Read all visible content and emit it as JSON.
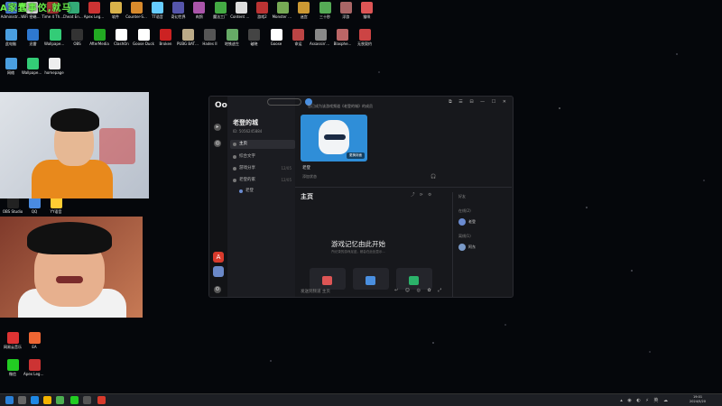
{
  "overlay_title": "A家蠢事佼,就马",
  "desktop_icons": [
    {
      "label": "Administr...",
      "color": "#4a7fd6"
    },
    {
      "label": "WiFi 密碼查看器",
      "color": "#d9d9d9"
    },
    {
      "label": "Time 4 The Nightmar...",
      "color": "#a33"
    },
    {
      "label": "Cheat Engine",
      "color": "#3a7"
    },
    {
      "label": "Apex Legends",
      "color": "#c33"
    },
    {
      "label": "软件",
      "color": "#d9b24a"
    },
    {
      "label": "Counter-Strike 2",
      "color": "#d88a2c"
    },
    {
      "label": "TT语音",
      "color": "#6cf"
    },
    {
      "label": "奇幻世界",
      "color": "#55a"
    },
    {
      "label": "肉鸽",
      "color": "#a5a"
    },
    {
      "label": "魔法工厂",
      "color": "#4a4"
    },
    {
      "label": "Content Warning",
      "color": "#ddd"
    },
    {
      "label": "游戏2",
      "color": "#b33"
    },
    {
      "label": "Monster Hunter...",
      "color": "#7a5"
    },
    {
      "label": "迷宫",
      "color": "#c93"
    },
    {
      "label": "三十秒",
      "color": "#5a5"
    },
    {
      "label": "浮游",
      "color": "#a66"
    },
    {
      "label": "猫咪",
      "color": "#d55"
    }
  ],
  "desktop_icons_row2": [
    {
      "label": "此电脑",
      "color": "#4a9fe0"
    },
    {
      "label": "迅雷",
      "color": "#2e78d0"
    },
    {
      "label": "Wallpaper Engine",
      "color": "#3c7"
    },
    {
      "label": "OBS",
      "color": "#333"
    },
    {
      "label": "AfterMedia",
      "color": "#2a2"
    },
    {
      "label": "ClashOn",
      "color": "#fff"
    },
    {
      "label": "Goose Duck",
      "color": "#fff"
    },
    {
      "label": "Broken",
      "color": "#c22"
    },
    {
      "label": "PUBG BATTLEGR...",
      "color": "#ba8"
    },
    {
      "label": "Hades II",
      "color": "#555"
    },
    {
      "label": "地铁逃生",
      "color": "#6a6"
    },
    {
      "label": "破晓",
      "color": "#444"
    },
    {
      "label": "Goose",
      "color": "#fff"
    },
    {
      "label": "命运",
      "color": "#b44"
    },
    {
      "label": "Assassin's Creed",
      "color": "#888"
    },
    {
      "label": "Blasphe...",
      "color": "#b66"
    },
    {
      "label": "无畏契约",
      "color": "#c44"
    }
  ],
  "desktop_icons_col": [
    {
      "label": "网络",
      "color": "#4a9fe0"
    },
    {
      "label": "Wallpaper Engine",
      "color": "#3c7"
    },
    {
      "label": "homepage",
      "color": "#eee"
    }
  ],
  "desktop_icons_bottom": [
    {
      "label": "OBS Studio",
      "color": "#222"
    },
    {
      "label": "QQ",
      "color": "#4a8be0"
    },
    {
      "label": "YY语音",
      "color": "#fc3"
    },
    {
      "label": "网易云音乐",
      "color": "#d33"
    },
    {
      "label": "EA",
      "color": "#e63"
    },
    {
      "label": "微信",
      "color": "#2c2"
    },
    {
      "label": "Apex Legends",
      "color": "#c33"
    }
  ],
  "app": {
    "logo": "Oopz",
    "sidebar": {
      "title": "老登的城",
      "id_text": "ID: 5056245884",
      "items": [
        {
          "label": "主页",
          "count": ""
        },
        {
          "label": "综合文字",
          "count": ""
        },
        {
          "label": "游戏分享",
          "count": "12/05"
        },
        {
          "label": "老登的家",
          "count": "12/05"
        },
        {
          "label": "老登",
          "count": ""
        }
      ]
    },
    "crumb": "您已成为该游戏频道《老登的城》的成员",
    "banner_change": "更换封面",
    "user_name": "老登",
    "user_line": "添加状态",
    "section_title": "主页",
    "empty_heading": "游戏记忆由此开始",
    "empty_sub": "所记录的游戏足迹，都会在此处显示...",
    "message_placeholder": "发送到频道 主页",
    "friends_online_label": "在线(2)",
    "friends_header": "好友",
    "friends_online": [
      {
        "name": "老登"
      }
    ],
    "friends_other_label": "离线(1)",
    "friends_other": [
      {
        "name": "阿东"
      }
    ]
  },
  "taskbar": {
    "time": "19:01",
    "date": "2024/5/20"
  }
}
